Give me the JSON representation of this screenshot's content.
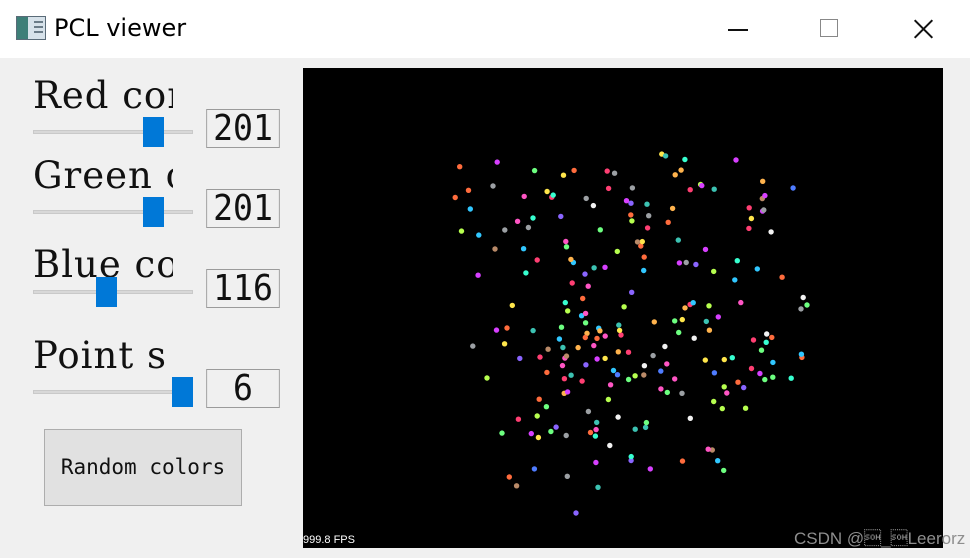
{
  "window": {
    "title": "PCL viewer",
    "controls": [
      "minimize-icon",
      "maximize-icon",
      "close-icon"
    ]
  },
  "controls": {
    "red": {
      "label": "Red compo",
      "value": "201",
      "level": 0.79
    },
    "green": {
      "label": "Green com",
      "value": "201",
      "level": 0.79
    },
    "blue": {
      "label": "Blue comp",
      "value": "116",
      "level": 0.45
    },
    "point_size": {
      "label": "Point s",
      "value": "6",
      "level": 1.0
    }
  },
  "buttons": {
    "random_colors": "Random colors"
  },
  "viewer": {
    "fps": "999.8 FPS",
    "background": "#000000",
    "point_colors": [
      "#ff3f73",
      "#ff55c4",
      "#d740ff",
      "#8a65ff",
      "#4f7cff",
      "#31c7ff",
      "#37ffd0",
      "#6dff80",
      "#b7ff4f",
      "#ffe64b",
      "#ffb34d",
      "#ff6c3d",
      "#b98a68",
      "#9ca0a4",
      "#3cc2b2",
      "#f2f2f2"
    ]
  },
  "watermark": "CSDN @\u0001_\u0001Leerorz",
  "colors": {
    "accent": "#0078d7",
    "button": "#e1e1e1",
    "panel": "#f0f0f0"
  }
}
